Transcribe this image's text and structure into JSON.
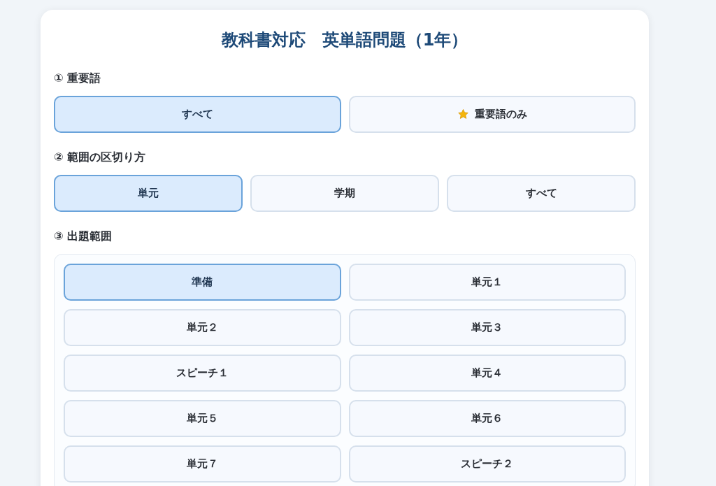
{
  "title": "教科書対応　英単語問題（1年）",
  "sections": [
    {
      "label": "① 重要語",
      "kind": "row",
      "options": [
        {
          "label": "すべて",
          "selected": true,
          "kind": "plain"
        },
        {
          "label": "重要語のみ",
          "selected": false,
          "kind": "starred"
        }
      ]
    },
    {
      "label": "② 範囲の区切り方",
      "kind": "row",
      "options": [
        {
          "label": "単元",
          "selected": true,
          "kind": "plain"
        },
        {
          "label": "学期",
          "selected": false,
          "kind": "plain"
        },
        {
          "label": "すべて",
          "selected": false,
          "kind": "plain"
        }
      ]
    },
    {
      "label": "③ 出題範囲",
      "kind": "panel",
      "options": [
        {
          "label": "準備",
          "selected": true,
          "kind": "plain"
        },
        {
          "label": "単元１",
          "selected": false,
          "kind": "plain"
        },
        {
          "label": "単元２",
          "selected": false,
          "kind": "plain"
        },
        {
          "label": "単元３",
          "selected": false,
          "kind": "plain"
        },
        {
          "label": "スピーチ１",
          "selected": false,
          "kind": "plain"
        },
        {
          "label": "単元４",
          "selected": false,
          "kind": "plain"
        },
        {
          "label": "単元５",
          "selected": false,
          "kind": "plain"
        },
        {
          "label": "単元６",
          "selected": false,
          "kind": "plain"
        },
        {
          "label": "単元７",
          "selected": false,
          "kind": "plain"
        },
        {
          "label": "スピーチ２",
          "selected": false,
          "kind": "plain"
        }
      ]
    }
  ]
}
